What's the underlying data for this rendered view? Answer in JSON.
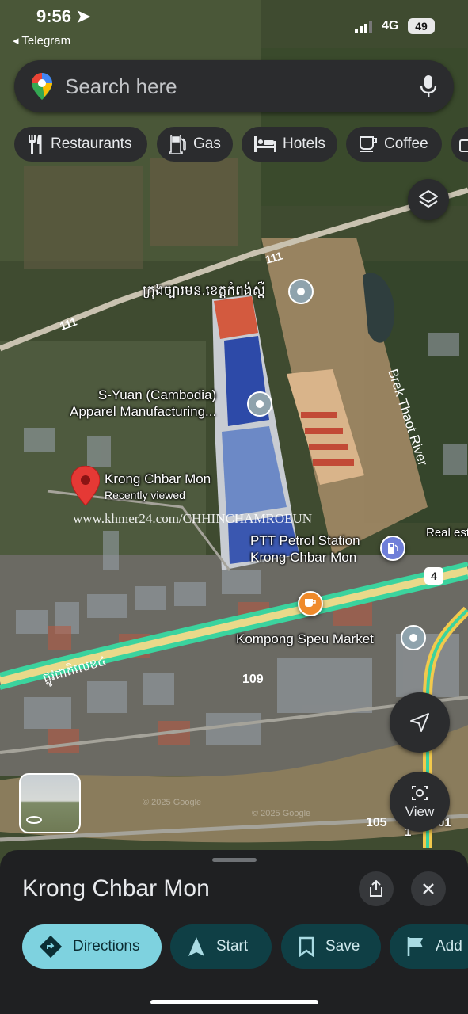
{
  "status_bar": {
    "time": "9:56",
    "back_app": "◂ Telegram",
    "network": "4G",
    "battery": "49"
  },
  "search": {
    "placeholder": "Search here"
  },
  "chips": [
    {
      "label": "Restaurants",
      "icon": "fork-knife-icon"
    },
    {
      "label": "Gas",
      "icon": "gas-pump-icon"
    },
    {
      "label": "Hotels",
      "icon": "bed-icon"
    },
    {
      "label": "Coffee",
      "icon": "coffee-cup-icon"
    }
  ],
  "map": {
    "road_labels": {
      "r111_a": "111",
      "r111_b": "111",
      "r109": "109",
      "r105": "105",
      "r4": "4",
      "r1a": "1",
      "r1b": "01"
    },
    "places": {
      "city_hall": "ក្រុងច្បារមន.ខេត្តកំពង់ស្ពឺ",
      "factory_line1": "S-Yuan (Cambodia)",
      "factory_line2": "Apparel Manufacturing...",
      "selected_name": "Krong Chbar Mon",
      "selected_sub": "Recently viewed",
      "river": "Brek Thaot River",
      "real_estate": "Real est",
      "ptt_line1": "PTT Petrol Station",
      "ptt_line2": "Krong Chbar Mon",
      "market": "Kompong Speu Market",
      "national_road": "ផ្លូវជាតិលេខ៤"
    },
    "watermark": "www.khmer24.com/CHHINCHAMROEUN",
    "copyright_1": "© 2025 Google",
    "copyright_2": "© 2025 Google",
    "view_button": "View"
  },
  "sheet": {
    "title": "Krong Chbar Mon",
    "actions": [
      {
        "label": "Directions",
        "icon": "directions-icon"
      },
      {
        "label": "Start",
        "icon": "navigation-arrow-icon"
      },
      {
        "label": "Save",
        "icon": "bookmark-icon"
      },
      {
        "label": "Add",
        "icon": "flag-icon"
      }
    ]
  },
  "colors": {
    "accent": "#7ed2df",
    "sheet_bg": "#1f2022",
    "chip_bg": "#2b2c2e",
    "pin_red": "#e53935"
  }
}
